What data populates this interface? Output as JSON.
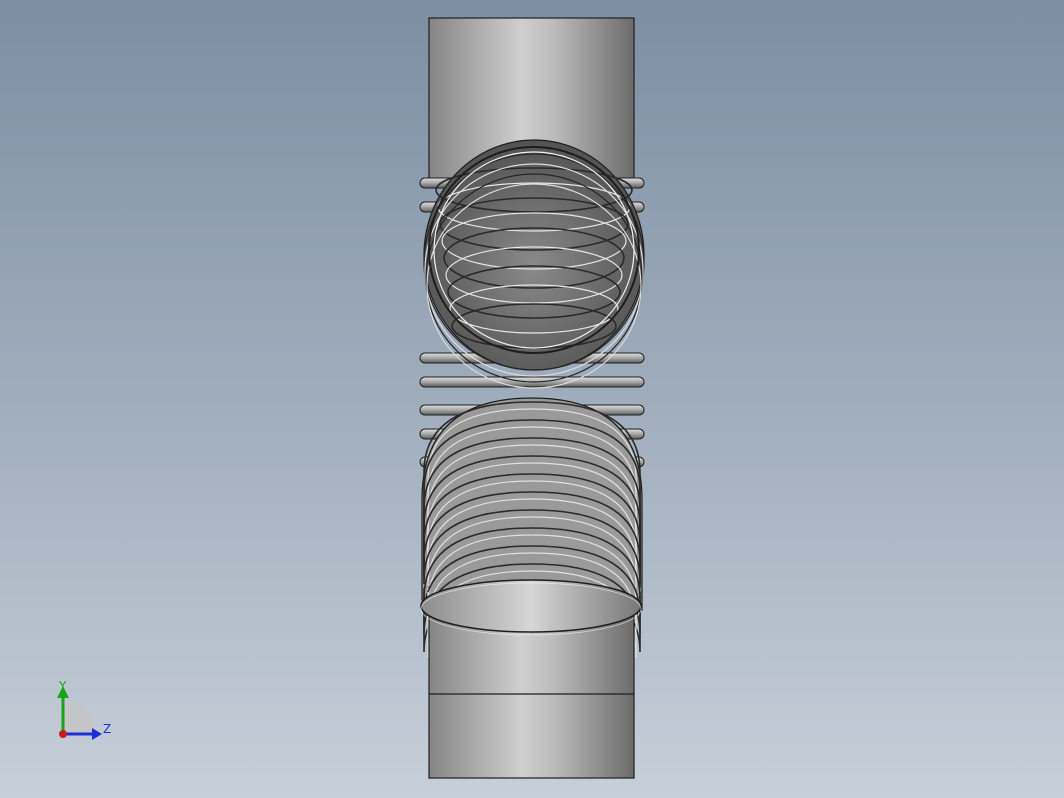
{
  "viewport": {
    "background_top": "#7d8ea3",
    "background_bottom": "#c7cfd9"
  },
  "model": {
    "type": "flexible-bellows-pipe-assembly",
    "shade_light": "#d0d0d0",
    "shade_dark": "#6e6e6e",
    "edge_color": "#1e1e1e"
  },
  "triad": {
    "y_label": "Y",
    "z_label": "Z",
    "y_color": "#1aa31a",
    "z_color": "#1f2fd6",
    "x_color": "#c81e1e"
  }
}
